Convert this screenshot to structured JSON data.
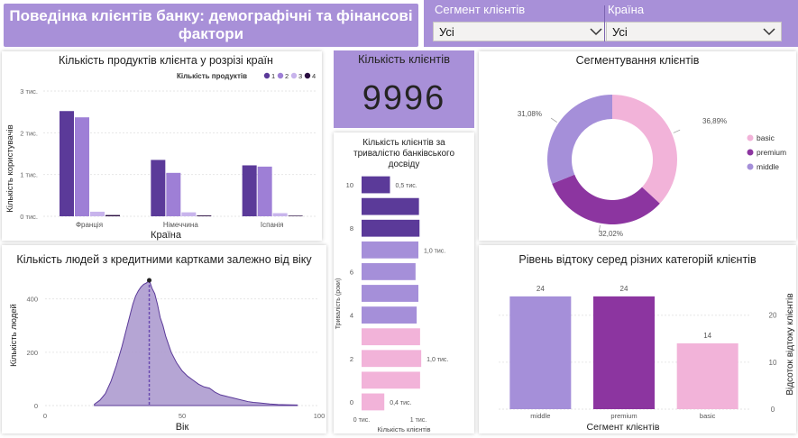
{
  "header": {
    "title_line1": "Поведінка клієнтів банку: демографічні та фінансові",
    "title_line2": "фактори"
  },
  "slicers": [
    {
      "label": "Сегмент клієнтів",
      "value": "Усі"
    },
    {
      "label": "Країна",
      "value": "Усі"
    }
  ],
  "kpi": {
    "title": "Кількість клієнтів",
    "value": "9996"
  },
  "colors": {
    "product1": "#5b3a99",
    "product2": "#9e7fd6",
    "product3": "#c8b4ec",
    "product4": "#2a0d40",
    "basic": "#f2b3d9",
    "premium": "#8c35a0",
    "middle": "#a58fd9",
    "area": "#a895cc"
  },
  "chart_data": [
    {
      "type": "bar",
      "title": "Кількість продуктів клієнта у розрізі країн",
      "legend_title": "Кількість продуктів",
      "legend_position": "top-right",
      "xlabel": "Країна",
      "ylabel": "Кількість користувачів",
      "y_ticks": [
        "0 тис.",
        "1 тис.",
        "2 тис.",
        "3 тис."
      ],
      "ylim": [
        0,
        3000
      ],
      "categories": [
        "Франція",
        "Німеччина",
        "Іспанія"
      ],
      "series": [
        {
          "name": "1",
          "values": [
            2520,
            1350,
            1220
          ]
        },
        {
          "name": "2",
          "values": [
            2370,
            1040,
            1190
          ]
        },
        {
          "name": "3",
          "values": [
            110,
            95,
            75
          ]
        },
        {
          "name": "4",
          "values": [
            30,
            20,
            15
          ]
        }
      ]
    },
    {
      "type": "pie",
      "title": "Сегментування клієнтів",
      "legend_position": "right",
      "labels": [
        "basic",
        "premium",
        "middle"
      ],
      "values": [
        36.89,
        32.02,
        31.08
      ],
      "value_labels": [
        "36,89%",
        "32,02%",
        "31,08%"
      ]
    },
    {
      "type": "bar",
      "orientation": "horizontal",
      "title": "Кількість клієнтів за тривалістю банківського досвіду",
      "xlabel": "Кількість клієнтів",
      "ylabel": "Тривалість (роки)",
      "x_ticks": [
        "0 тис.",
        "1 тис."
      ],
      "xlim": [
        0,
        1000
      ],
      "y_tick_labels": [
        "10",
        "8",
        "6",
        "4",
        "2",
        "0"
      ],
      "categories": [
        10,
        9,
        8,
        7,
        6,
        5,
        4,
        3,
        2,
        1,
        0
      ],
      "values": [
        500,
        1010,
        1020,
        1000,
        950,
        1000,
        970,
        1030,
        1050,
        1030,
        400
      ],
      "data_labels": [
        {
          "category": 10,
          "text": "0,5 тис."
        },
        {
          "category": 7,
          "text": "1,0 тис."
        },
        {
          "category": 2,
          "text": "1,0 тис."
        },
        {
          "category": 0,
          "text": "0,4 тис."
        }
      ]
    },
    {
      "type": "area",
      "title": "Кількість людей з кредитними картками залежно від віку",
      "xlabel": "Вік",
      "ylabel": "Кількість людей",
      "xlim": [
        0,
        100
      ],
      "ylim": [
        0,
        480
      ],
      "x_ticks": [
        0,
        50,
        100
      ],
      "y_ticks": [
        0,
        200,
        400
      ],
      "reference_line": {
        "x": 38,
        "style": "dashed"
      },
      "x": [
        18,
        20,
        22,
        24,
        26,
        28,
        30,
        31,
        32,
        33,
        34,
        35,
        36,
        37,
        38,
        39,
        40,
        41,
        42,
        43,
        44,
        45,
        46,
        48,
        50,
        52,
        54,
        56,
        58,
        60,
        62,
        64,
        66,
        68,
        70,
        72,
        74,
        76,
        78,
        80,
        82,
        85,
        88,
        92
      ],
      "y": [
        5,
        20,
        45,
        90,
        150,
        220,
        300,
        340,
        380,
        410,
        430,
        445,
        455,
        460,
        470,
        440,
        420,
        380,
        330,
        300,
        260,
        230,
        200,
        160,
        130,
        110,
        95,
        80,
        70,
        65,
        50,
        40,
        35,
        30,
        25,
        20,
        15,
        12,
        10,
        8,
        6,
        4,
        3,
        2
      ]
    },
    {
      "type": "bar",
      "title": "Рівень відтоку серед різних категорій клієнтів",
      "xlabel": "Сегмент клієнтів",
      "ylabel": "Відсоток відтоку клієнтів",
      "ylim": [
        0,
        28
      ],
      "y_ticks": [
        0,
        10,
        20
      ],
      "categories": [
        "middle",
        "premium",
        "basic"
      ],
      "values": [
        24,
        24,
        14
      ],
      "data_labels": [
        "24",
        "24",
        "14"
      ]
    }
  ]
}
